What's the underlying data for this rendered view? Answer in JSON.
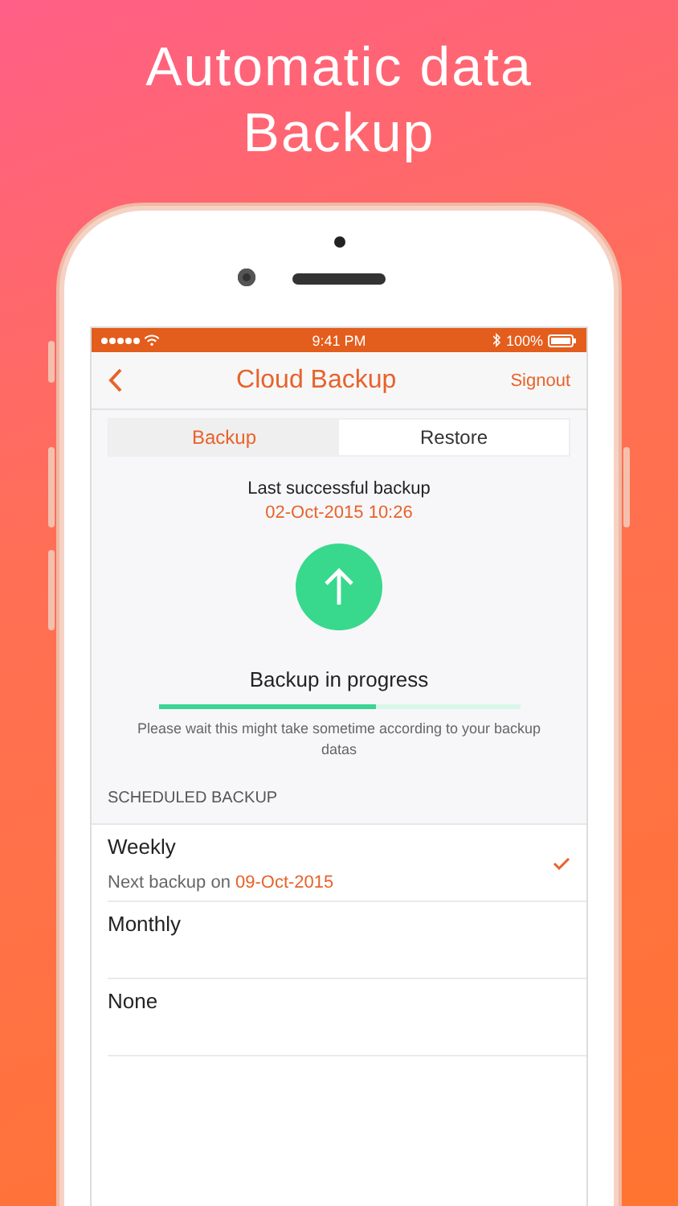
{
  "headline": "Automatic data Backup",
  "status_bar": {
    "time": "9:41 PM",
    "battery": "100%"
  },
  "nav": {
    "title": "Cloud Backup",
    "action": "Signout"
  },
  "tabs": [
    {
      "label": "Backup",
      "selected": true
    },
    {
      "label": "Restore",
      "selected": false
    }
  ],
  "last_backup": {
    "label": "Last successful backup",
    "date": "02-Oct-2015 10:26"
  },
  "progress": {
    "label": "Backup in progress",
    "level": 0.6,
    "note": "Please wait this might take sometime according to your backup datas"
  },
  "schedule": {
    "header": "SCHEDULED BACKUP",
    "options": [
      {
        "label": "Weekly",
        "selected": true,
        "next_label": "Next backup on",
        "next_date": "09-Oct-2015"
      },
      {
        "label": "Monthly",
        "selected": false
      },
      {
        "label": "None",
        "selected": false
      }
    ]
  }
}
